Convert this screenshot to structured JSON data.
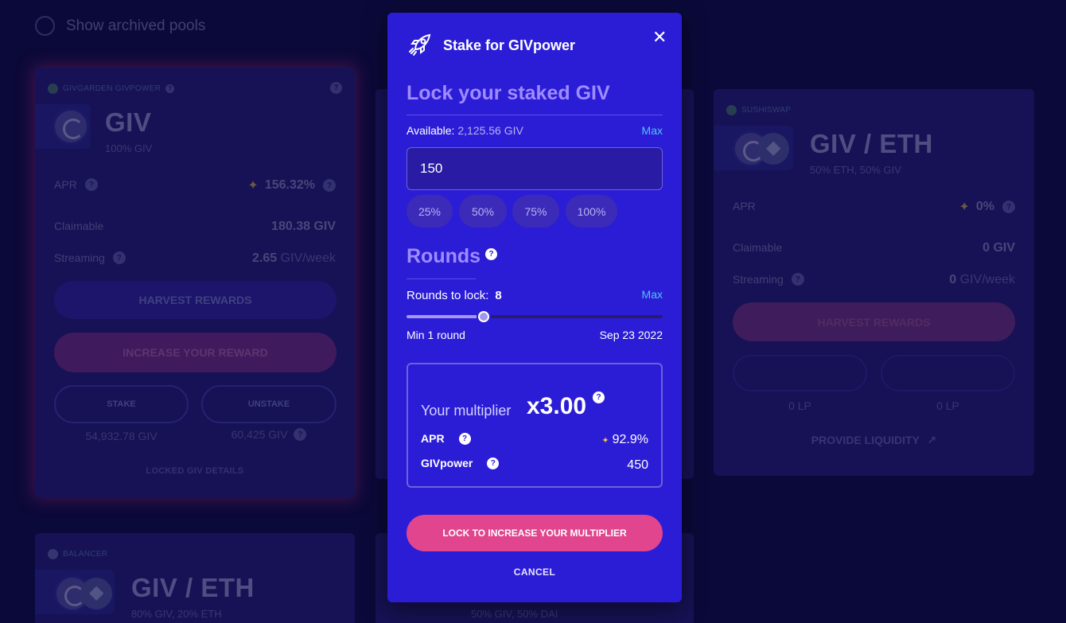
{
  "archived_toggle": {
    "label": "Show archived pools"
  },
  "cards": {
    "giv_stake": {
      "platform": "GIVGARDEN GIVPOWER",
      "title": "GIV",
      "subtitle": "100% GIV",
      "apr_label": "APR",
      "apr_value": "156.32%",
      "claimable_label": "Claimable",
      "claimable_value": "180.38 GIV",
      "streaming_label": "Streaming",
      "streaming_value": "2.65",
      "streaming_unit": "GIV/week",
      "harvest_label": "HARVEST REWARDS",
      "increase_label": "INCREASE YOUR REWARD",
      "stake_label": "STAKE",
      "unstake_label": "UNSTAKE",
      "stake_amount": "54,932.78 GIV",
      "unstake_amount": "60,425 GIV",
      "locked_details_label": "LOCKED GIV DETAILS"
    },
    "sushiswap": {
      "platform": "SUSHISWAP",
      "title": "GIV / ETH",
      "subtitle": "50% ETH, 50% GIV",
      "apr_label": "APR",
      "apr_value": "0%",
      "claimable_label": "Claimable",
      "claimable_value": "0 GIV",
      "streaming_label": "Streaming",
      "streaming_value": "0",
      "streaming_unit": "GIV/week",
      "harvest_label": "HARVEST REWARDS",
      "stake_amount": "0 LP",
      "unstake_amount": "0 LP",
      "provide_liquidity_label": "PROVIDE LIQUIDITY"
    },
    "balancer": {
      "platform": "BALANCER",
      "title": "GIV / ETH",
      "subtitle": "80% GIV, 20% ETH"
    },
    "middle_bottom": {
      "subtitle": "50% GIV, 50% DAI"
    }
  },
  "modal": {
    "title": "Stake for GIVpower",
    "lock_heading": "Lock your staked GIV",
    "available_label": "Available:",
    "available_value": "2,125.56 GIV",
    "max_label": "Max",
    "input_value": "150",
    "percent_buttons": [
      "25%",
      "50%",
      "75%",
      "100%"
    ],
    "rounds_heading": "Rounds",
    "rounds_label": "Rounds to lock:",
    "rounds_value": "8",
    "rounds_max_label": "Max",
    "slider_fraction": 0.3,
    "slider_min_label": "Min 1 round",
    "slider_end_label": "Sep 23 2022",
    "multiplier_label": "Your multiplier",
    "multiplier_value": "x3.00",
    "apr_label": "APR",
    "apr_value": "92.9%",
    "givpower_label": "GIVpower",
    "givpower_value": "450",
    "lock_button": "LOCK TO INCREASE YOUR MULTIPLIER",
    "cancel_button": "CANCEL"
  },
  "colors": {
    "background": "#0c0a3e",
    "card": "#1f1a72",
    "modal": "#2b1dd6",
    "accent_pink": "#e1458d",
    "link_blue": "#4dc5f2"
  }
}
